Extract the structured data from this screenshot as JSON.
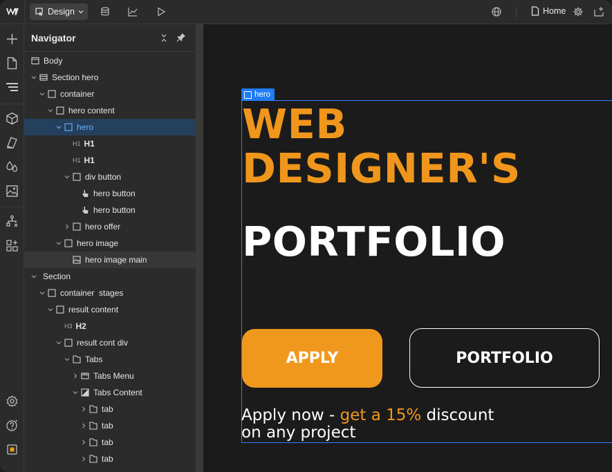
{
  "topbar": {
    "mode_label": "Design",
    "page_label": "Home"
  },
  "navigator": {
    "title": "Navigator",
    "rows": [
      {
        "label": "Body",
        "icon": "body-icon"
      },
      {
        "label": "Section hero",
        "icon": "section-icon"
      },
      {
        "label": "container",
        "icon": "box-icon"
      },
      {
        "label": "hero content",
        "icon": "box-icon"
      },
      {
        "label": "hero",
        "icon": "box-icon"
      },
      {
        "label": "H1",
        "prefix": "H1"
      },
      {
        "label": "H1",
        "prefix": "H1"
      },
      {
        "label": "div button",
        "icon": "box-icon"
      },
      {
        "label": "hero button",
        "icon": "pointer-icon"
      },
      {
        "label": "hero button",
        "icon": "pointer-icon"
      },
      {
        "label": "hero offer",
        "icon": "box-icon"
      },
      {
        "label": "hero image",
        "icon": "box-icon"
      },
      {
        "label": "hero image main",
        "icon": "image-icon"
      },
      {
        "label": "Section",
        "icon": "none"
      },
      {
        "label": "container  stages",
        "icon": "box-icon"
      },
      {
        "label": "result content",
        "icon": "box-icon"
      },
      {
        "label": "H2",
        "prefix": "H3"
      },
      {
        "label": "result cont div",
        "icon": "box-icon"
      },
      {
        "label": "Tabs",
        "icon": "tabs-icon"
      },
      {
        "label": "Tabs Menu",
        "icon": "tabs-menu-icon"
      },
      {
        "label": "Tabs Content",
        "icon": "tabs-content-icon"
      },
      {
        "label": "tab",
        "icon": "tab-icon"
      },
      {
        "label": "tab",
        "icon": "tab-icon"
      },
      {
        "label": "tab",
        "icon": "tab-icon"
      },
      {
        "label": "tab",
        "icon": "tab-icon"
      }
    ]
  },
  "canvas": {
    "selection_tag": "hero",
    "headline_line1": "WEB",
    "headline_line2": "DESIGNER'S",
    "headline_line3": "PORTFOLIO",
    "apply_button": "APPLY",
    "portfolio_button": "PORTFOLIO",
    "offer_prefix": "Apply now - ",
    "offer_accent": "get a 15%",
    "offer_suffix": " discount",
    "offer_line2": "on any project"
  },
  "colors": {
    "accent": "#f0981e",
    "selection": "#2f82ff",
    "selected_row": "#24405c"
  }
}
